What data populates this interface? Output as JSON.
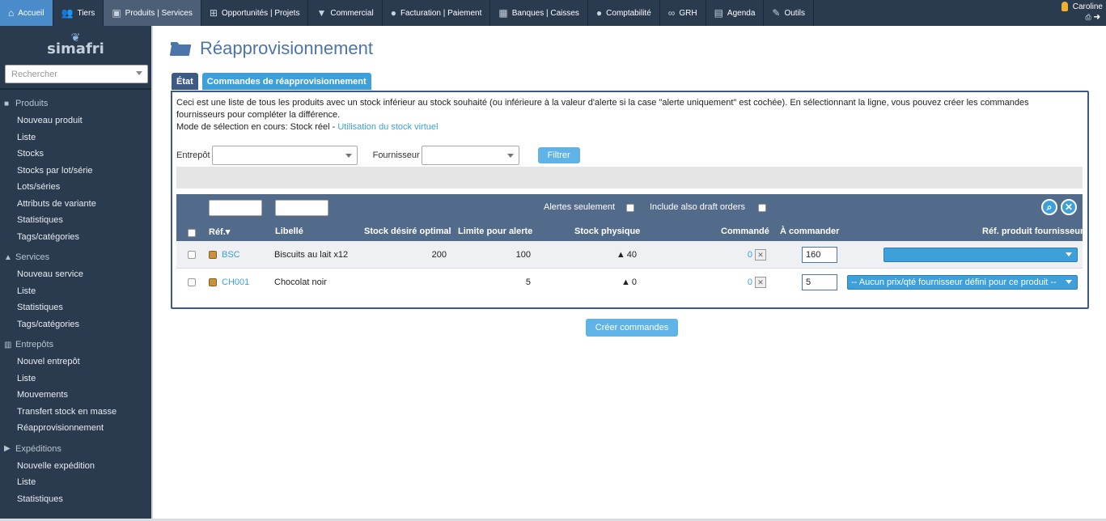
{
  "topnav": {
    "items": [
      {
        "label": "Accueil",
        "icon": "home-icon"
      },
      {
        "label": "Tiers",
        "icon": "users-icon"
      },
      {
        "label": "Produits | Services",
        "icon": "box-icon"
      },
      {
        "label": "Opportunités | Projets",
        "icon": "sitemap-icon"
      },
      {
        "label": "Commercial",
        "icon": "tie-icon"
      },
      {
        "label": "Facturation | Paiement",
        "icon": "piggy-bank-icon"
      },
      {
        "label": "Banques | Caisses",
        "icon": "safe-icon"
      },
      {
        "label": "Comptabilité",
        "icon": "piggy-bank-icon"
      },
      {
        "label": "GRH",
        "icon": "glasses-icon"
      },
      {
        "label": "Agenda",
        "icon": "calendar-icon"
      },
      {
        "label": "Outils",
        "icon": "wrench-icon"
      }
    ],
    "user": "Caroline"
  },
  "sidebar": {
    "logo_text": "simafri",
    "search_placeholder": "Rechercher",
    "sections": [
      {
        "title": "Produits",
        "icon": "box-icon",
        "items": [
          "Nouveau produit",
          "Liste",
          "Stocks",
          "Stocks par lot/série",
          "Lots/séries",
          "Attributs de variante",
          "Statistiques",
          "Tags/catégories"
        ]
      },
      {
        "title": "Services",
        "icon": "bell-icon",
        "items": [
          "Nouveau service",
          "Liste",
          "Statistiques",
          "Tags/catégories"
        ]
      },
      {
        "title": "Entrepôts",
        "icon": "warehouse-icon",
        "items": [
          "Nouvel entrepôt",
          "Liste",
          "Mouvements",
          "Transfert stock en masse",
          "Réapprovisionnement"
        ]
      },
      {
        "title": "Expéditions",
        "icon": "truck-icon",
        "items": [
          "Nouvelle expédition",
          "Liste",
          "Statistiques"
        ]
      }
    ]
  },
  "page": {
    "title": "Réapprovisionnement",
    "tabs": [
      "État",
      "Commandes de réapprovisionnement"
    ],
    "description": "Ceci est une liste de tous les produits avec un stock inférieur au stock souhaité (ou inférieure à la valeur d'alerte si la case \"alerte uniquement\" est cochée). En sélectionnant la ligne, vous pouvez créer les commandes fournisseurs pour compléter la différence.",
    "mode_text": "Mode de sélection en cours: Stock réel - ",
    "mode_link": "Utilisation du stock virtuel",
    "filters": {
      "warehouse_label": "Entrepôt",
      "supplier_label": "Fournisseur",
      "filter_button": "Filtrer"
    },
    "table": {
      "alerts_only_label": "Alertes seulement",
      "draft_orders_label": "Include also draft orders",
      "headers": {
        "ref": "Réf.",
        "label": "Libellé",
        "desired_stock": "Stock désiré optimal",
        "alert_limit": "Limite pour alerte",
        "physical_stock": "Stock physique",
        "ordered": "Commandé",
        "to_order": "À commander",
        "supplier_ref": "Réf. produit fournisseur"
      },
      "rows": [
        {
          "ref": "BSC",
          "label": "Biscuits au lait x12",
          "desired_stock": "200",
          "alert_limit": "100",
          "physical_stock": "40",
          "ordered": "0",
          "to_order": "160",
          "supplier_option": ""
        },
        {
          "ref": "CH001",
          "label": "Chocolat noir",
          "desired_stock": "",
          "alert_limit": "5",
          "physical_stock": "0",
          "ordered": "0",
          "to_order": "5",
          "supplier_option": "-- Aucun prix/qté fournisseur défini pour ce produit --"
        }
      ]
    },
    "create_button": "Créer commandes"
  },
  "colors": {
    "topbar": "#2a3a4f",
    "accent": "#3da0d8",
    "header": "#536b8b",
    "title": "#4b74a8"
  }
}
